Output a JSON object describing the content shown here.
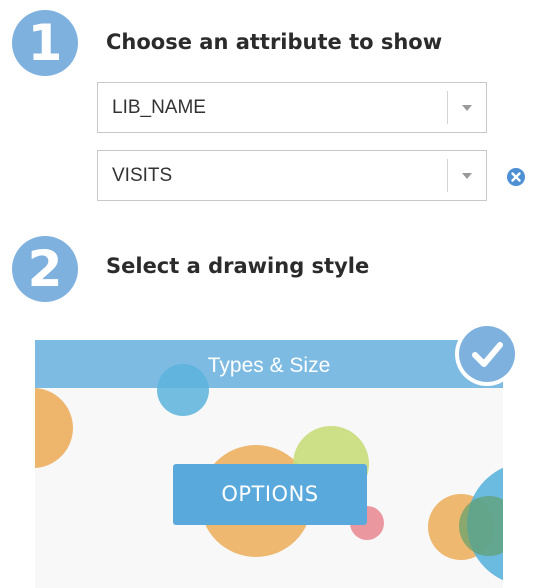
{
  "step1": {
    "number": "1",
    "title": "Choose an attribute to show"
  },
  "attributes": [
    {
      "value": "LIB_NAME"
    },
    {
      "value": "VISITS"
    }
  ],
  "step2": {
    "number": "2",
    "title": "Select a drawing style"
  },
  "style_card": {
    "header": "Types & Size",
    "options_label": "OPTIONS",
    "selected": true
  },
  "colors": {
    "step_badge": "#7fb1df",
    "card_header": "#7dbbe3",
    "options_button": "#5aa9dd",
    "remove_icon": "#4d90d4",
    "bubble_orange": "#ecae5c",
    "bubble_blue": "#5bb3dc",
    "bubble_green": "#c8dc7a",
    "bubble_pink": "#e98c95"
  },
  "icons": {
    "remove": "close-circle-icon",
    "dropdown": "chevron-down-icon",
    "selected": "checkmark-icon"
  }
}
